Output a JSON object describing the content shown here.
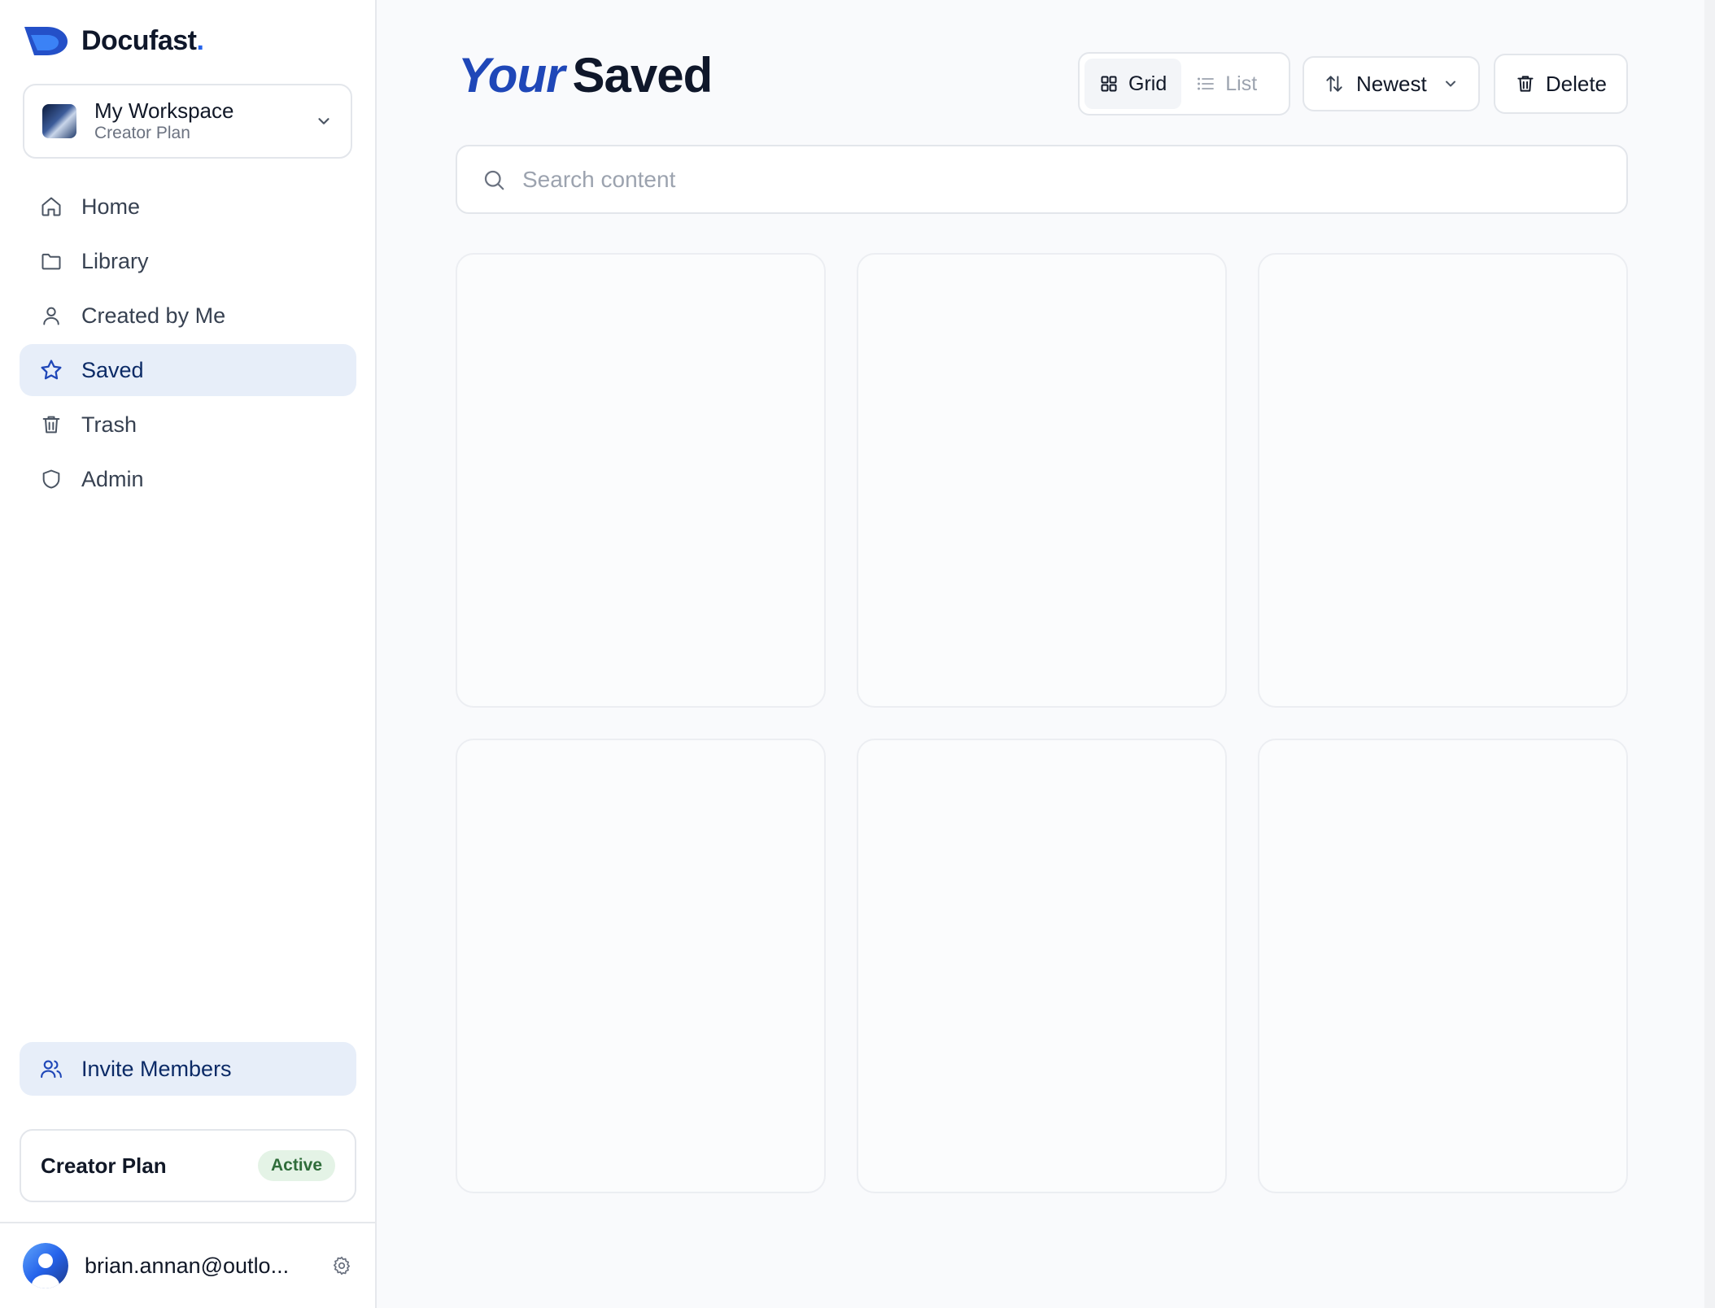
{
  "brand": {
    "name": "Docufast",
    "dot": "."
  },
  "workspace": {
    "name": "My Workspace",
    "plan": "Creator Plan"
  },
  "nav": [
    {
      "label": "Home",
      "icon": "home-icon",
      "active": false
    },
    {
      "label": "Library",
      "icon": "folder-icon",
      "active": false
    },
    {
      "label": "Created by Me",
      "icon": "user-icon",
      "active": false
    },
    {
      "label": "Saved",
      "icon": "star-icon",
      "active": true
    },
    {
      "label": "Trash",
      "icon": "trash-icon",
      "active": false
    },
    {
      "label": "Admin",
      "icon": "shield-icon",
      "active": false
    }
  ],
  "invite": {
    "label": "Invite Members"
  },
  "plan_card": {
    "name": "Creator Plan",
    "status": "Active"
  },
  "user": {
    "email": "brian.annan@outlo..."
  },
  "page": {
    "title_em": "Your",
    "title": "Saved"
  },
  "view_toggle": {
    "grid_label": "Grid",
    "list_label": "List",
    "selected": "Grid"
  },
  "sort": {
    "label": "Newest"
  },
  "delete": {
    "label": "Delete"
  },
  "search": {
    "placeholder": "Search content",
    "value": ""
  },
  "cards": [
    {},
    {},
    {},
    {},
    {},
    {}
  ],
  "colors": {
    "accent": "#2563eb",
    "active_nav_bg": "#e7eef9",
    "active_nav_text": "#0b2a66",
    "badge_bg": "#e4f3e6",
    "badge_text": "#2f6d3a"
  }
}
